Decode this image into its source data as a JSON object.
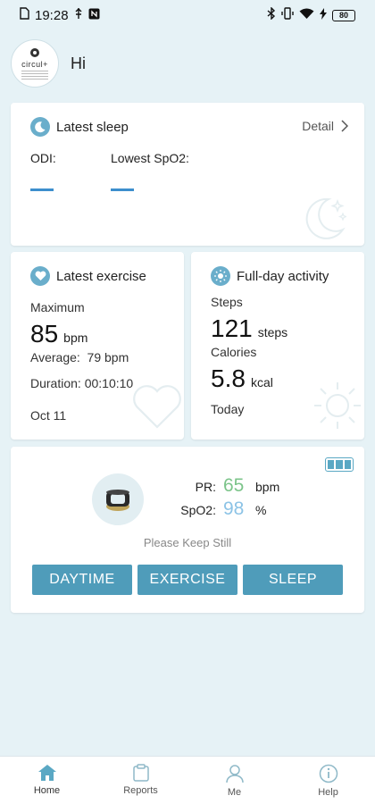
{
  "status_bar": {
    "time": "19:28",
    "battery": "80"
  },
  "header": {
    "greeting": "Hi",
    "avatar_logo": "circul+"
  },
  "sleep_card": {
    "title": "Latest sleep",
    "detail_label": "Detail",
    "odi_label": "ODI:",
    "odi_value": "—",
    "spo2_label": "Lowest SpO2:",
    "spo2_value": "—"
  },
  "exercise_card": {
    "title": "Latest exercise",
    "maximum_label": "Maximum",
    "maximum_value": "85",
    "maximum_unit": "bpm",
    "average_text": "Average:  79 bpm",
    "duration_text": "Duration: 00:10:10",
    "date": "Oct 11"
  },
  "activity_card": {
    "title": "Full-day activity",
    "steps_label": "Steps",
    "steps_value": "121",
    "steps_unit": "steps",
    "calories_label": "Calories",
    "calories_value": "5.8",
    "calories_unit": "kcal",
    "period": "Today"
  },
  "monitor_card": {
    "pr_label": "PR:",
    "pr_value": "65",
    "pr_unit": "bpm",
    "spo2_label": "SpO2:",
    "spo2_value": "98",
    "spo2_unit": "%",
    "hint": "Please Keep Still",
    "modes": [
      "DAYTIME",
      "EXERCISE",
      "SLEEP"
    ],
    "colors": {
      "pr": "#7cc48a",
      "spo2": "#8cc3e6",
      "button": "#4f9cba"
    }
  },
  "bottom_nav": {
    "items": [
      {
        "label": "Home",
        "icon": "home-icon",
        "active": true
      },
      {
        "label": "Reports",
        "icon": "reports-icon",
        "active": false
      },
      {
        "label": "Me",
        "icon": "person-icon",
        "active": false
      },
      {
        "label": "Help",
        "icon": "info-icon",
        "active": false
      }
    ]
  }
}
